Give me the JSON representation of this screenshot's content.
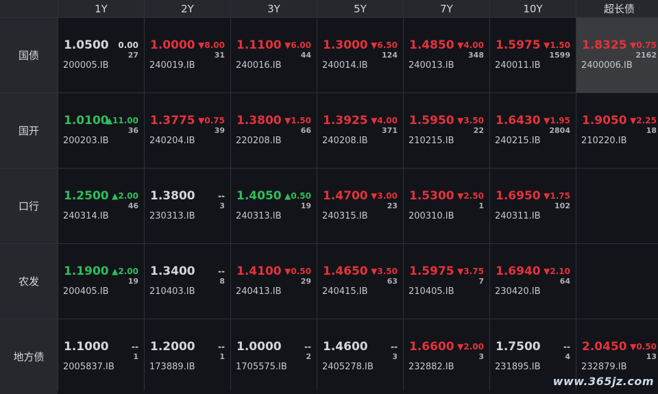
{
  "columns": [
    "1Y",
    "2Y",
    "3Y",
    "5Y",
    "7Y",
    "10Y",
    "超长债"
  ],
  "rows": [
    {
      "label": "国债",
      "cells": [
        {
          "price": "1.0500",
          "change": "0.00",
          "dir": "flat",
          "count": "27",
          "code": "200005.IB"
        },
        {
          "price": "1.0000",
          "change": "▼8.00",
          "dir": "down",
          "count": "31",
          "code": "240019.IB"
        },
        {
          "price": "1.1100",
          "change": "▼6.00",
          "dir": "down",
          "count": "44",
          "code": "240016.IB"
        },
        {
          "price": "1.3000",
          "change": "▼6.50",
          "dir": "down",
          "count": "124",
          "code": "240014.IB"
        },
        {
          "price": "1.4850",
          "change": "▼4.00",
          "dir": "down",
          "count": "348",
          "code": "240013.IB"
        },
        {
          "price": "1.5975",
          "change": "▼1.50",
          "dir": "down",
          "count": "1599",
          "code": "240011.IB"
        },
        {
          "price": "1.8325",
          "change": "▼0.75",
          "dir": "down",
          "count": "2162",
          "code": "2400006.IB",
          "selected": true
        }
      ]
    },
    {
      "label": "国开",
      "cells": [
        {
          "price": "1.0100",
          "change": "▲11.00",
          "dir": "up",
          "count": "36",
          "code": "200203.IB"
        },
        {
          "price": "1.3775",
          "change": "▼0.75",
          "dir": "down",
          "count": "39",
          "code": "240204.IB"
        },
        {
          "price": "1.3800",
          "change": "▼1.50",
          "dir": "down",
          "count": "66",
          "code": "220208.IB"
        },
        {
          "price": "1.3925",
          "change": "▼4.00",
          "dir": "down",
          "count": "371",
          "code": "240208.IB"
        },
        {
          "price": "1.5950",
          "change": "▼3.50",
          "dir": "down",
          "count": "22",
          "code": "210215.IB"
        },
        {
          "price": "1.6430",
          "change": "▼1.95",
          "dir": "down",
          "count": "2804",
          "code": "240215.IB"
        },
        {
          "price": "1.9050",
          "change": "▼2.25",
          "dir": "down",
          "count": "18",
          "code": "210220.IB"
        }
      ]
    },
    {
      "label": "口行",
      "cells": [
        {
          "price": "1.2500",
          "change": "▲2.00",
          "dir": "up",
          "count": "46",
          "code": "240314.IB"
        },
        {
          "price": "1.3800",
          "change": "--",
          "dir": "flat",
          "count": "3",
          "code": "230313.IB"
        },
        {
          "price": "1.4050",
          "change": "▲0.50",
          "dir": "up",
          "count": "19",
          "code": "240313.IB"
        },
        {
          "price": "1.4700",
          "change": "▼3.00",
          "dir": "down",
          "count": "23",
          "code": "240315.IB"
        },
        {
          "price": "1.5300",
          "change": "▼2.50",
          "dir": "down",
          "count": "1",
          "code": "200310.IB"
        },
        {
          "price": "1.6950",
          "change": "▼1.75",
          "dir": "down",
          "count": "102",
          "code": "240311.IB"
        },
        null
      ]
    },
    {
      "label": "农发",
      "cells": [
        {
          "price": "1.1900",
          "change": "▲2.00",
          "dir": "up",
          "count": "19",
          "code": "200405.IB"
        },
        {
          "price": "1.3400",
          "change": "--",
          "dir": "flat",
          "count": "8",
          "code": "210403.IB"
        },
        {
          "price": "1.4100",
          "change": "▼0.50",
          "dir": "down",
          "count": "29",
          "code": "240413.IB"
        },
        {
          "price": "1.4650",
          "change": "▼3.50",
          "dir": "down",
          "count": "63",
          "code": "240415.IB"
        },
        {
          "price": "1.5975",
          "change": "▼3.75",
          "dir": "down",
          "count": "7",
          "code": "210405.IB"
        },
        {
          "price": "1.6940",
          "change": "▼2.10",
          "dir": "down",
          "count": "64",
          "code": "230420.IB"
        },
        null
      ]
    },
    {
      "label": "地方债",
      "cells": [
        {
          "price": "1.1000",
          "change": "--",
          "dir": "flat",
          "count": "1",
          "code": "2005837.IB"
        },
        {
          "price": "1.2000",
          "change": "--",
          "dir": "flat",
          "count": "1",
          "code": "173889.IB"
        },
        {
          "price": "1.0000",
          "change": "--",
          "dir": "flat",
          "count": "2",
          "code": "1705575.IB"
        },
        {
          "price": "1.4600",
          "change": "--",
          "dir": "flat",
          "count": "3",
          "code": "2405278.IB"
        },
        {
          "price": "1.6600",
          "change": "▼2.00",
          "dir": "down",
          "count": "3",
          "code": "232882.IB"
        },
        {
          "price": "1.7500",
          "change": "--",
          "dir": "flat",
          "count": "4",
          "code": "231895.IB"
        },
        {
          "price": "2.0450",
          "change": "▼0.50",
          "dir": "down",
          "count": "13",
          "code": "232879.IB"
        }
      ]
    }
  ],
  "watermark": "www.365jz.com",
  "colors": {
    "up": "#2fbe5a",
    "down": "#e5323b",
    "flat": "#d4d6da",
    "background": "#121419",
    "header": "#26282d",
    "selected": "#3a3b3f"
  }
}
